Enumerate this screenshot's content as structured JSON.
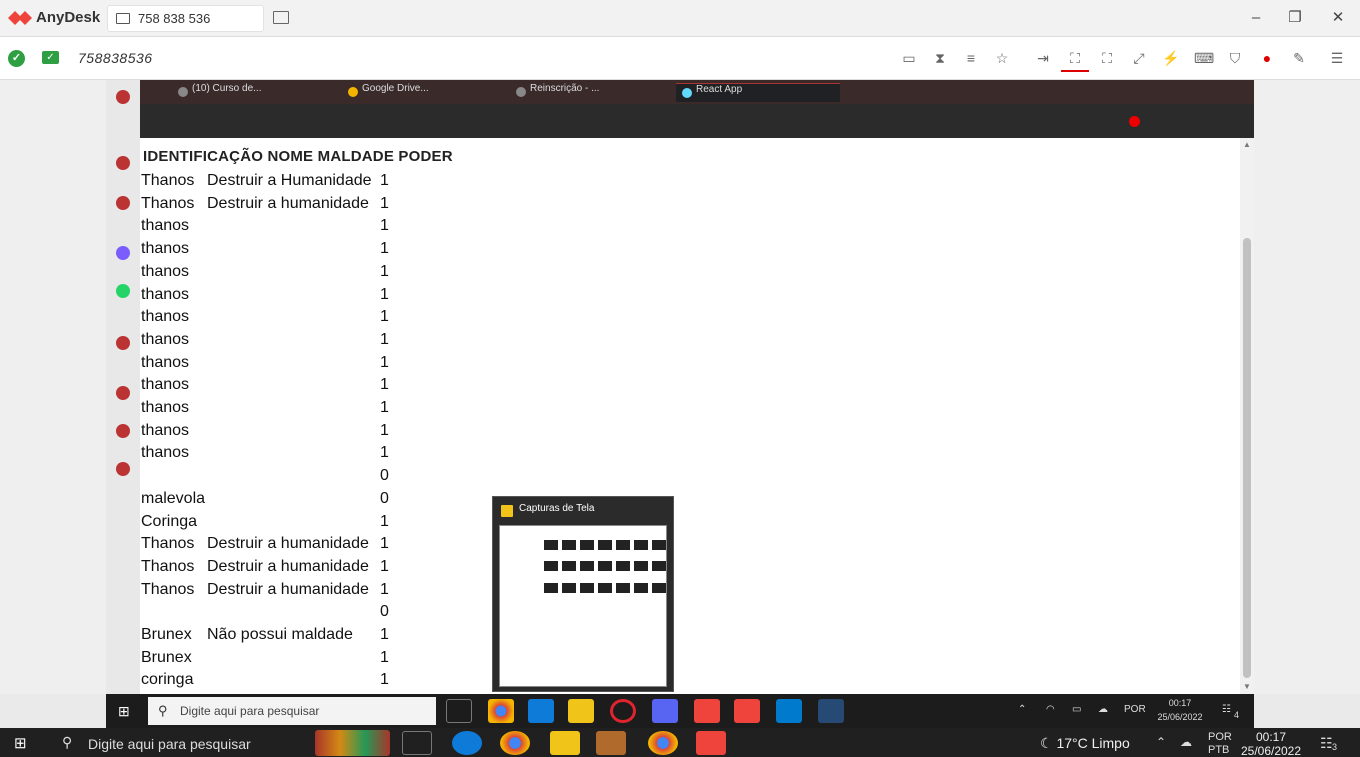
{
  "anydesk": {
    "app_name": "AnyDesk",
    "tab_label": "758 838 536",
    "address": "758838536"
  },
  "remote_browser": {
    "tabs": [
      "(10) Curso de...",
      "Google Drive...",
      "Reinscrição - ...",
      "React App"
    ]
  },
  "table": {
    "header": "IDENTIFICAÇÃO NOME MALDADE PODER",
    "rows": [
      {
        "nome": "Thanos",
        "maldade": "Destruir a Humanidade",
        "poder": "1"
      },
      {
        "nome": "Thanos",
        "maldade": "Destruir a humanidade",
        "poder": "1"
      },
      {
        "nome": "thanos",
        "maldade": "",
        "poder": "1"
      },
      {
        "nome": "thanos",
        "maldade": "",
        "poder": "1"
      },
      {
        "nome": "thanos",
        "maldade": "",
        "poder": "1"
      },
      {
        "nome": "thanos",
        "maldade": "",
        "poder": "1"
      },
      {
        "nome": "thanos",
        "maldade": "",
        "poder": "1"
      },
      {
        "nome": "thanos",
        "maldade": "",
        "poder": "1"
      },
      {
        "nome": "thanos",
        "maldade": "",
        "poder": "1"
      },
      {
        "nome": "thanos",
        "maldade": "",
        "poder": "1"
      },
      {
        "nome": "thanos",
        "maldade": "",
        "poder": "1"
      },
      {
        "nome": "thanos",
        "maldade": "",
        "poder": "1"
      },
      {
        "nome": "thanos",
        "maldade": "",
        "poder": "1"
      },
      {
        "nome": "",
        "maldade": "",
        "poder": "0"
      },
      {
        "nome": "malevola",
        "maldade": "",
        "poder": "0"
      },
      {
        "nome": "Coringa",
        "maldade": "",
        "poder": "1"
      },
      {
        "nome": "Thanos",
        "maldade": "Destruir a humanidade",
        "poder": "1"
      },
      {
        "nome": "Thanos",
        "maldade": "Destruir a humanidade",
        "poder": "1"
      },
      {
        "nome": "Thanos",
        "maldade": "Destruir a humanidade",
        "poder": "1"
      },
      {
        "nome": "",
        "maldade": "",
        "poder": "0"
      },
      {
        "nome": "Brunex",
        "maldade": "Não possui maldade",
        "poder": "1"
      },
      {
        "nome": "Brunex",
        "maldade": "",
        "poder": "1"
      },
      {
        "nome": "coringa",
        "maldade": "",
        "poder": "1"
      }
    ]
  },
  "preview": {
    "title": "Capturas de Tela"
  },
  "inner_taskbar": {
    "search_placeholder": "Digite aqui para pesquisar",
    "lang": "POR",
    "time": "00:17",
    "date": "25/06/2022",
    "notif_count": "4"
  },
  "outer_taskbar": {
    "search_placeholder": "Digite aqui para pesquisar",
    "temperature": "17°C",
    "weather": "Limpo",
    "lang": "POR",
    "lang_sub": "PTB",
    "time": "00:17",
    "date": "25/06/2022",
    "notif_count": "3"
  },
  "colors": {
    "anydesk_red": "#ef443b",
    "ok_green": "#2ea043",
    "taskbar": "#202020"
  },
  "icons": [
    "anydesk-logo-icon",
    "monitor-icon",
    "check-circle-icon",
    "screen-icon",
    "record-icon",
    "chrome-icon",
    "edge-icon",
    "folder-icon",
    "vscode-icon",
    "windows-start-icon",
    "search-icon",
    "moon-icon",
    "cloud-icon",
    "wifi-icon",
    "notification-icon"
  ]
}
